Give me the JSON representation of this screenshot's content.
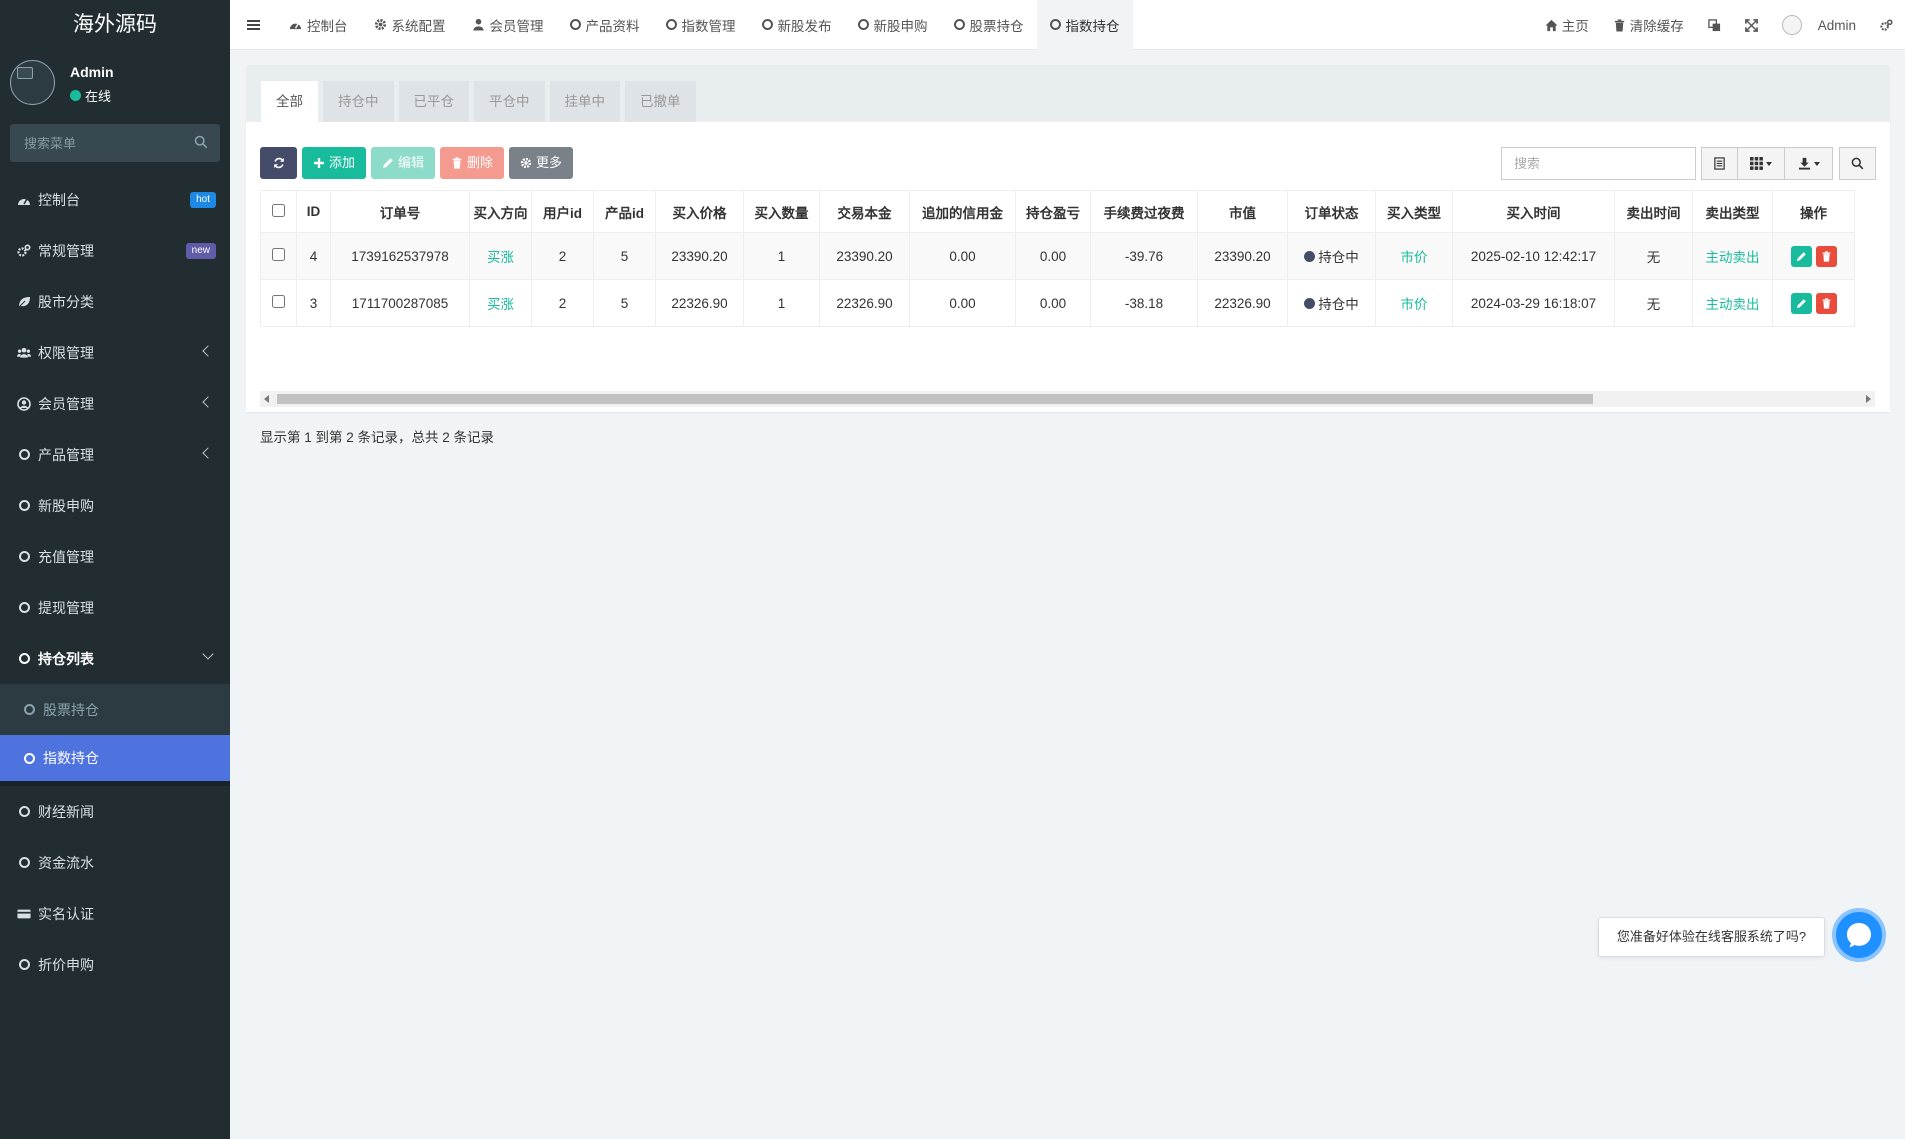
{
  "sidebar": {
    "brand": "海外源码",
    "user": {
      "name": "Admin",
      "status": "在线"
    },
    "search_placeholder": "搜索菜单",
    "items": [
      {
        "label": "控制台",
        "badge": "hot",
        "badge_color": "#1e88e5"
      },
      {
        "label": "常规管理",
        "badge": "new",
        "badge_color": "#605ca8"
      },
      {
        "label": "股市分类"
      },
      {
        "label": "权限管理"
      },
      {
        "label": "会员管理"
      },
      {
        "label": "产品管理"
      },
      {
        "label": "新股申购"
      },
      {
        "label": "充值管理"
      },
      {
        "label": "提现管理"
      },
      {
        "label": "持仓列表"
      },
      {
        "label": "财经新闻"
      },
      {
        "label": "资金流水"
      },
      {
        "label": "实名认证"
      },
      {
        "label": "折价申购"
      }
    ],
    "submenu": [
      {
        "label": "股票持仓"
      },
      {
        "label": "指数持仓"
      }
    ]
  },
  "topbar": {
    "tabs": [
      {
        "label": "控制台"
      },
      {
        "label": "系统配置"
      },
      {
        "label": "会员管理"
      },
      {
        "label": "产品资料"
      },
      {
        "label": "指数管理"
      },
      {
        "label": "新股发布"
      },
      {
        "label": "新股申购"
      },
      {
        "label": "股票持仓"
      },
      {
        "label": "指数持仓"
      }
    ],
    "home": "主页",
    "clear_cache": "清除缓存",
    "admin": "Admin"
  },
  "panel": {
    "filter_tabs": [
      "全部",
      "持仓中",
      "已平仓",
      "平仓中",
      "挂单中",
      "已撤单"
    ],
    "buttons": {
      "add": "添加",
      "edit": "编辑",
      "delete": "删除",
      "more": "更多"
    },
    "search_placeholder": "搜索",
    "columns": [
      "ID",
      "订单号",
      "买入方向",
      "用户id",
      "产品id",
      "买入价格",
      "买入数量",
      "交易本金",
      "追加的信用金",
      "持仓盈亏",
      "手续费过夜费",
      "市值",
      "订单状态",
      "买入类型",
      "买入时间",
      "卖出时间",
      "卖出类型",
      "操作"
    ],
    "rows": [
      {
        "id": "4",
        "order_no": "1739162537978",
        "direction": "买涨",
        "user_id": "2",
        "product_id": "5",
        "price": "23390.20",
        "qty": "1",
        "principal": "23390.20",
        "credit": "0.00",
        "pnl": "0.00",
        "fee": "-39.76",
        "market_value": "23390.20",
        "status": "持仓中",
        "buy_type": "市价",
        "buy_time": "2025-02-10 12:42:17",
        "sell_time": "无",
        "sell_type": "主动卖出"
      },
      {
        "id": "3",
        "order_no": "1711700287085",
        "direction": "买涨",
        "user_id": "2",
        "product_id": "5",
        "price": "22326.90",
        "qty": "1",
        "principal": "22326.90",
        "credit": "0.00",
        "pnl": "0.00",
        "fee": "-38.18",
        "market_value": "22326.90",
        "status": "持仓中",
        "buy_type": "市价",
        "buy_time": "2024-03-29 16:18:07",
        "sell_time": "无",
        "sell_type": "主动卖出"
      }
    ],
    "pager_info": "显示第 1 到第 2 条记录，总共 2 条记录"
  },
  "chat": {
    "prompt": "您准备好体验在线客服系统了吗?"
  },
  "colors": {
    "sidebar_bg": "#222d32",
    "accent_green": "#18bc9c",
    "active_blue": "#4e73df",
    "danger": "#e74c3c"
  }
}
